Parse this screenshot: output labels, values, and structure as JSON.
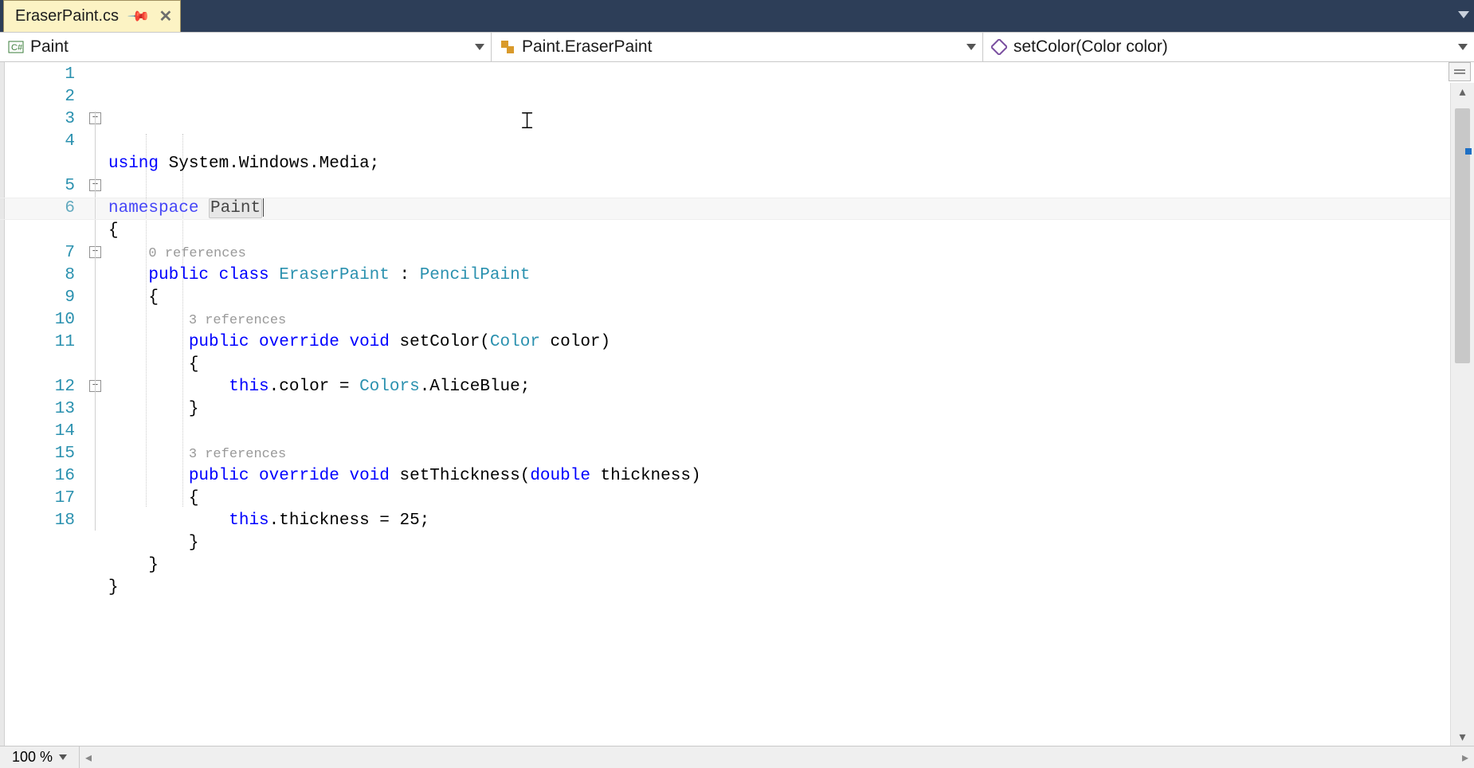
{
  "tab": {
    "filename": "EraserPaint.cs"
  },
  "nav": {
    "project": "Paint",
    "class": "Paint.EraserPaint",
    "member": "setColor(Color color)"
  },
  "zoom": "100 %",
  "colors": {
    "keyword": "#0000ff",
    "type": "#2b91af",
    "reference": "#999999",
    "background": "#ffffff",
    "tab_bg": "#fcf3c4",
    "titlebar": "#2d3e58"
  },
  "code": {
    "lines": [
      {
        "n": 1,
        "tokens": [
          {
            "t": "using ",
            "c": "kw"
          },
          {
            "t": "System.Windows.Media;",
            "c": "pln"
          }
        ]
      },
      {
        "n": 2,
        "tokens": []
      },
      {
        "n": 3,
        "tokens": [
          {
            "t": "namespace ",
            "c": "kw"
          },
          {
            "t": "Paint",
            "c": "pln hl"
          }
        ],
        "fold": true,
        "current": true
      },
      {
        "n": 4,
        "tokens": [
          {
            "t": "{",
            "c": "pln"
          }
        ]
      },
      {
        "n": 5,
        "ref": "0 references",
        "tokens": [
          {
            "t": "    ",
            "c": "pln"
          },
          {
            "t": "public class ",
            "c": "kw"
          },
          {
            "t": "EraserPaint",
            "c": "typ"
          },
          {
            "t": " : ",
            "c": "pln"
          },
          {
            "t": "PencilPaint",
            "c": "typ"
          }
        ],
        "fold": true
      },
      {
        "n": 6,
        "tokens": [
          {
            "t": "    {",
            "c": "pln"
          }
        ]
      },
      {
        "n": 7,
        "ref": "3 references",
        "tokens": [
          {
            "t": "        ",
            "c": "pln"
          },
          {
            "t": "public override void ",
            "c": "kw"
          },
          {
            "t": "setColor(",
            "c": "pln"
          },
          {
            "t": "Color",
            "c": "typ"
          },
          {
            "t": " color)",
            "c": "pln"
          }
        ],
        "fold": true
      },
      {
        "n": 8,
        "tokens": [
          {
            "t": "        {",
            "c": "pln"
          }
        ]
      },
      {
        "n": 9,
        "tokens": [
          {
            "t": "            ",
            "c": "pln"
          },
          {
            "t": "this",
            "c": "kw"
          },
          {
            "t": ".color = ",
            "c": "pln"
          },
          {
            "t": "Colors",
            "c": "typ"
          },
          {
            "t": ".AliceBlue;",
            "c": "pln"
          }
        ]
      },
      {
        "n": 10,
        "tokens": [
          {
            "t": "        }",
            "c": "pln"
          }
        ]
      },
      {
        "n": 11,
        "tokens": []
      },
      {
        "n": 12,
        "ref": "3 references",
        "tokens": [
          {
            "t": "        ",
            "c": "pln"
          },
          {
            "t": "public override void ",
            "c": "kw"
          },
          {
            "t": "setThickness(",
            "c": "pln"
          },
          {
            "t": "double",
            "c": "kw"
          },
          {
            "t": " thickness)",
            "c": "pln"
          }
        ],
        "fold": true
      },
      {
        "n": 13,
        "tokens": [
          {
            "t": "        {",
            "c": "pln"
          }
        ]
      },
      {
        "n": 14,
        "tokens": [
          {
            "t": "            ",
            "c": "pln"
          },
          {
            "t": "this",
            "c": "kw"
          },
          {
            "t": ".thickness = 25;",
            "c": "pln"
          }
        ]
      },
      {
        "n": 15,
        "tokens": [
          {
            "t": "        }",
            "c": "pln"
          }
        ]
      },
      {
        "n": 16,
        "tokens": [
          {
            "t": "    }",
            "c": "pln"
          }
        ]
      },
      {
        "n": 17,
        "tokens": [
          {
            "t": "}",
            "c": "pln"
          }
        ]
      },
      {
        "n": 18,
        "tokens": []
      }
    ]
  }
}
